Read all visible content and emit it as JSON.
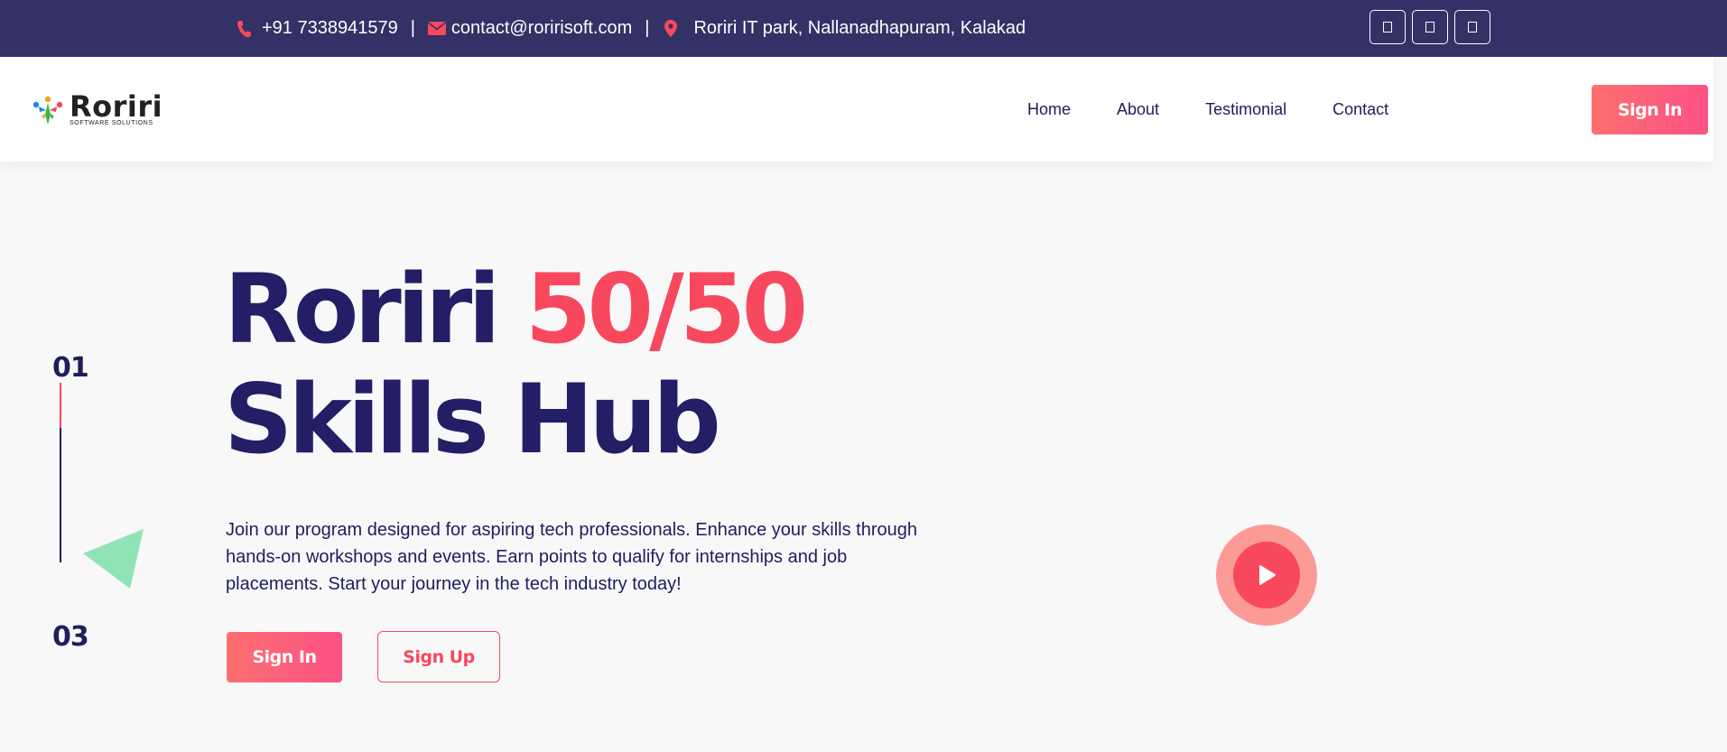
{
  "topbar": {
    "phone": "+91 7338941579",
    "separator": "|",
    "email": "contact@roririsoft.com",
    "address": "Roriri IT park, Nallanadhapuram, Kalakad",
    "phone_icon": "phone-icon",
    "email_icon": "envelope-icon",
    "address_icon": "map-pin-icon",
    "social_icons": [
      "social-icon-1",
      "social-icon-2",
      "social-icon-3"
    ]
  },
  "brand": {
    "name": "Roriri",
    "tagline": "SOFTWARE SOLUTIONS"
  },
  "nav": {
    "items": [
      "Home",
      "About",
      "Testimonial",
      "Contact"
    ],
    "signin_label": "Sign In"
  },
  "hero": {
    "slide_current": "01",
    "slide_total": "03",
    "title_part1": "Roriri",
    "title_accent": "50/50",
    "title_line2": "Skills Hub",
    "description": "Join our program designed for aspiring tech professionals. Enhance your skills through hands-on workshops and events. Earn points to qualify for internships and job placements. Start your journey in the tech industry today!",
    "signin_label": "Sign In",
    "signup_label": "Sign Up"
  },
  "colors": {
    "topbar_bg": "#343166",
    "navy": "#1f1d5c",
    "accent": "#f8485e",
    "button_gradient_start": "#fd6f6f",
    "button_gradient_end": "#fc5185",
    "triangle": "#8fe3b4",
    "page_bg": "#f8f8f9"
  }
}
